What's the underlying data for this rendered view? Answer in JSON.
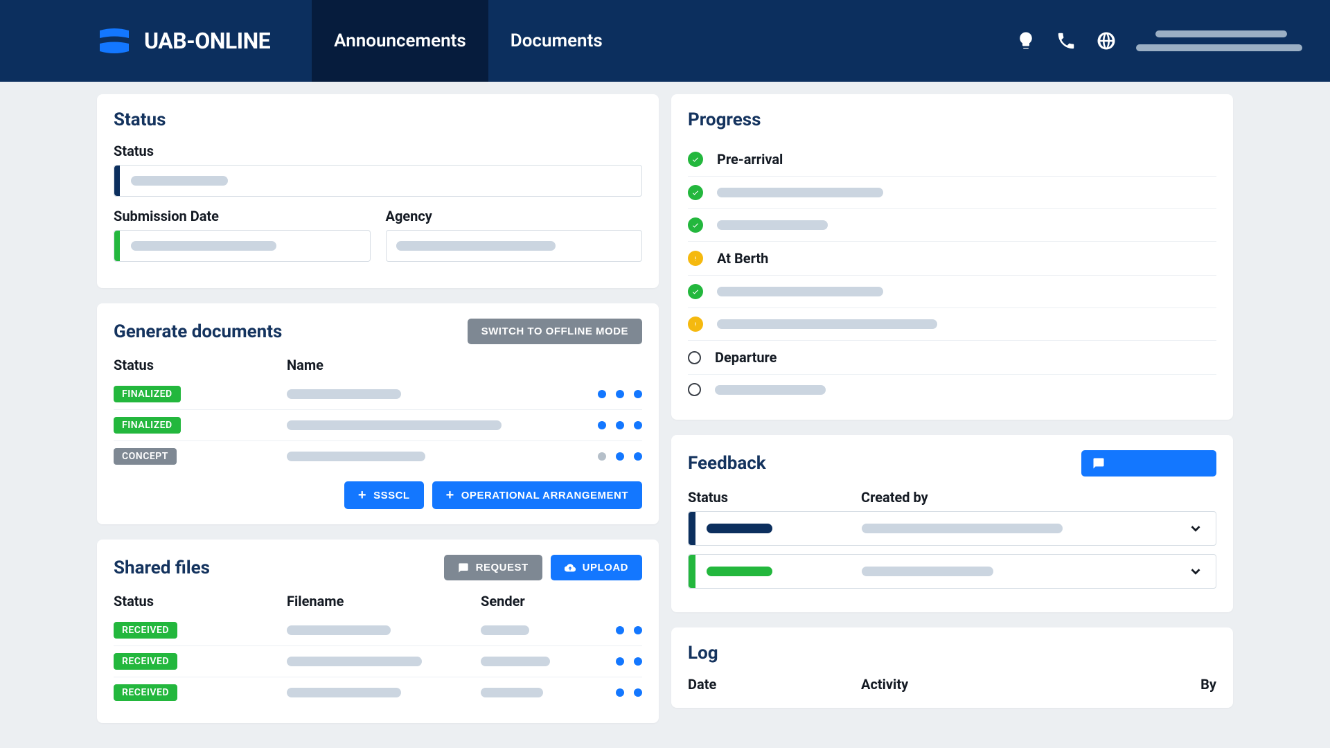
{
  "header": {
    "brand": "UAB-ONLINE",
    "tabs": [
      {
        "label": "Announcements",
        "active": true
      },
      {
        "label": "Documents",
        "active": false
      }
    ]
  },
  "status_card": {
    "title": "Status",
    "labels": {
      "status": "Status",
      "submission_date": "Submission Date",
      "agency": "Agency"
    }
  },
  "generate_docs": {
    "title": "Generate documents",
    "switch_btn": "SWITCH TO OFFLINE MODE",
    "headers": {
      "status": "Status",
      "name": "Name"
    },
    "rows": [
      {
        "badge": "FINALIZED",
        "badge_type": "green",
        "name_w": 165,
        "dots": [
          "blue",
          "blue",
          "blue"
        ]
      },
      {
        "badge": "FINALIZED",
        "badge_type": "green",
        "name_w": 310,
        "dots": [
          "blue",
          "blue",
          "blue"
        ]
      },
      {
        "badge": "CONCEPT",
        "badge_type": "gray",
        "name_w": 200,
        "dots": [
          "gray",
          "blue",
          "blue"
        ]
      }
    ],
    "buttons": {
      "ssscl": "SSSCL",
      "op_arr": "OPERATIONAL ARRANGEMENT"
    }
  },
  "shared_files": {
    "title": "Shared files",
    "request_btn": "REQUEST",
    "upload_btn": "UPLOAD",
    "headers": {
      "status": "Status",
      "filename": "Filename",
      "sender": "Sender"
    },
    "rows": [
      {
        "badge": "RECEIVED",
        "filename_w": 150,
        "sender_w": 70
      },
      {
        "badge": "RECEIVED",
        "filename_w": 195,
        "sender_w": 100
      },
      {
        "badge": "RECEIVED",
        "filename_w": 165,
        "sender_w": 90
      }
    ]
  },
  "progress": {
    "title": "Progress",
    "items": [
      {
        "icon": "check",
        "label": "Pre-arrival",
        "is_text": true
      },
      {
        "icon": "check",
        "placeholder_w": 240
      },
      {
        "icon": "check",
        "placeholder_w": 160
      },
      {
        "icon": "warn",
        "label": "At Berth",
        "is_text": true
      },
      {
        "icon": "check",
        "placeholder_w": 240
      },
      {
        "icon": "warn",
        "placeholder_w": 318
      },
      {
        "icon": "empty",
        "label": "Departure",
        "is_text": true
      },
      {
        "icon": "empty",
        "placeholder_w": 160
      }
    ]
  },
  "feedback": {
    "title": "Feedback",
    "headers": {
      "status": "Status",
      "created_by": "Created by"
    },
    "rows": [
      {
        "type": "navy",
        "status_w": 95,
        "created_w": 290
      },
      {
        "type": "green",
        "status_w": 95,
        "created_w": 190
      }
    ]
  },
  "log": {
    "title": "Log",
    "headers": {
      "date": "Date",
      "activity": "Activity",
      "by": "By"
    }
  }
}
